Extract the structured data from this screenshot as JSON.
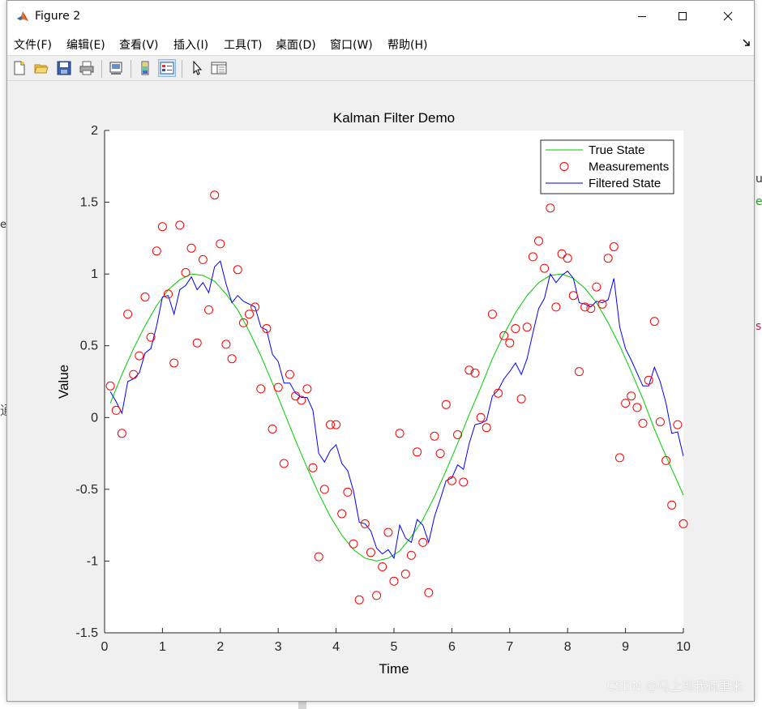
{
  "window": {
    "title": "Figure 2",
    "controls": {
      "minimize": "minimize",
      "maximize": "maximize",
      "close": "close"
    }
  },
  "menu": [
    {
      "label": "文件(F)"
    },
    {
      "label": "编辑(E)"
    },
    {
      "label": "查看(V)"
    },
    {
      "label": "插入(I)"
    },
    {
      "label": "工具(T)"
    },
    {
      "label": "桌面(D)"
    },
    {
      "label": "窗口(W)"
    },
    {
      "label": "帮助(H)"
    }
  ],
  "toolbar": {
    "icons": [
      "new-figure-icon",
      "open-file-icon",
      "save-icon",
      "print-icon",
      "link-plot-icon",
      "colorbar-icon",
      "legend-icon",
      "pointer-icon",
      "property-inspector-icon"
    ]
  },
  "background_fragments": {
    "left_e": "e",
    "left_glyph": "通",
    "right_u": "u",
    "right_e": "e",
    "right_s": "s"
  },
  "watermark": "CSDN @马上到我碗里来",
  "chart_data": {
    "type": "line",
    "title": "Kalman Filter Demo",
    "xlabel": "Time",
    "ylabel": "Value",
    "xlim": [
      0,
      10
    ],
    "ylim": [
      -1.5,
      2
    ],
    "xticks": [
      "0",
      "1",
      "2",
      "3",
      "4",
      "5",
      "6",
      "7",
      "8",
      "9",
      "10"
    ],
    "yticks": [
      "-1.5",
      "-1",
      "-0.5",
      "0",
      "0.5",
      "1",
      "1.5",
      "2"
    ],
    "legend_position": "top-right",
    "grid": false,
    "colors": {
      "true_state": "#00cc00",
      "measurements": "#ff0000",
      "filtered": "#0000ff",
      "axes_bg": "#ffffff"
    },
    "series": [
      {
        "name": "True State",
        "style": "line",
        "x": [
          0.1,
          0.3,
          0.5,
          0.7,
          0.9,
          1.1,
          1.3,
          1.5,
          1.7,
          1.9,
          2.1,
          2.3,
          2.5,
          2.7,
          2.9,
          3.1,
          3.3,
          3.5,
          3.7,
          3.9,
          4.1,
          4.3,
          4.5,
          4.7,
          4.9,
          5.1,
          5.3,
          5.5,
          5.7,
          5.9,
          6.1,
          6.3,
          6.5,
          6.7,
          6.9,
          7.1,
          7.3,
          7.5,
          7.7,
          7.9,
          8.1,
          8.3,
          8.5,
          8.7,
          8.9,
          9.1,
          9.3,
          9.5,
          9.7,
          10.0
        ],
        "y": [
          0.1,
          0.3,
          0.48,
          0.64,
          0.78,
          0.89,
          0.96,
          1.0,
          0.99,
          0.95,
          0.86,
          0.75,
          0.6,
          0.43,
          0.24,
          0.04,
          -0.16,
          -0.35,
          -0.53,
          -0.69,
          -0.82,
          -0.92,
          -0.98,
          -1.0,
          -0.98,
          -0.93,
          -0.83,
          -0.71,
          -0.55,
          -0.37,
          -0.18,
          0.02,
          0.21,
          0.41,
          0.58,
          0.73,
          0.85,
          0.94,
          0.99,
          1.0,
          0.97,
          0.9,
          0.8,
          0.66,
          0.5,
          0.32,
          0.13,
          -0.08,
          -0.27,
          -0.54
        ]
      },
      {
        "name": "Measurements",
        "style": "marker",
        "x": [
          0.1,
          0.2,
          0.3,
          0.4,
          0.5,
          0.6,
          0.7,
          0.8,
          0.9,
          1.0,
          1.1,
          1.2,
          1.3,
          1.4,
          1.5,
          1.6,
          1.7,
          1.8,
          1.9,
          2.0,
          2.1,
          2.2,
          2.3,
          2.4,
          2.5,
          2.6,
          2.7,
          2.8,
          2.9,
          3.0,
          3.1,
          3.2,
          3.3,
          3.4,
          3.5,
          3.6,
          3.7,
          3.8,
          3.9,
          4.0,
          4.1,
          4.2,
          4.3,
          4.4,
          4.5,
          4.6,
          4.7,
          4.8,
          4.9,
          5.0,
          5.1,
          5.2,
          5.3,
          5.4,
          5.5,
          5.6,
          5.7,
          5.8,
          5.9,
          6.0,
          6.1,
          6.2,
          6.3,
          6.4,
          6.5,
          6.6,
          6.7,
          6.8,
          6.9,
          7.0,
          7.1,
          7.2,
          7.3,
          7.4,
          7.5,
          7.6,
          7.7,
          7.8,
          7.9,
          8.0,
          8.1,
          8.2,
          8.3,
          8.4,
          8.5,
          8.6,
          8.7,
          8.8,
          8.9,
          9.0,
          9.1,
          9.2,
          9.3,
          9.4,
          9.5,
          9.6,
          9.7,
          9.8,
          9.9,
          10.0
        ],
        "y": [
          0.22,
          0.05,
          -0.11,
          0.72,
          0.3,
          0.43,
          0.84,
          0.56,
          1.16,
          1.33,
          0.86,
          0.38,
          1.34,
          1.01,
          1.18,
          0.52,
          1.1,
          0.75,
          1.55,
          1.21,
          0.51,
          0.41,
          1.03,
          0.66,
          0.72,
          0.77,
          0.2,
          0.62,
          -0.08,
          0.21,
          -0.32,
          0.3,
          0.15,
          0.12,
          0.2,
          -0.35,
          -0.97,
          -0.5,
          -0.05,
          -0.05,
          -0.67,
          -0.52,
          -0.88,
          -1.27,
          -0.74,
          -0.94,
          -1.24,
          -1.04,
          -0.8,
          -1.14,
          -0.11,
          -1.09,
          -0.96,
          -0.24,
          -0.87,
          -1.22,
          -0.13,
          -0.25,
          0.09,
          -0.44,
          -0.12,
          -0.45,
          0.33,
          0.31,
          0.0,
          -0.07,
          0.72,
          0.17,
          0.57,
          0.52,
          0.62,
          0.13,
          0.63,
          1.12,
          1.23,
          1.04,
          1.46,
          0.77,
          1.14,
          1.11,
          0.85,
          0.32,
          0.77,
          0.76,
          0.91,
          0.79,
          1.11,
          1.19,
          -0.28,
          0.1,
          0.15,
          0.07,
          -0.04,
          0.26,
          0.67,
          -0.03,
          -0.3,
          -0.61,
          -0.05,
          -0.74
        ]
      },
      {
        "name": "Filtered State",
        "style": "line",
        "x": [
          0.1,
          0.2,
          0.3,
          0.4,
          0.5,
          0.6,
          0.7,
          0.8,
          0.9,
          1.0,
          1.1,
          1.2,
          1.3,
          1.4,
          1.5,
          1.6,
          1.7,
          1.8,
          1.9,
          2.0,
          2.1,
          2.2,
          2.3,
          2.4,
          2.5,
          2.6,
          2.7,
          2.8,
          2.9,
          3.0,
          3.1,
          3.2,
          3.3,
          3.4,
          3.5,
          3.6,
          3.7,
          3.8,
          3.9,
          4.0,
          4.1,
          4.2,
          4.3,
          4.4,
          4.5,
          4.6,
          4.7,
          4.8,
          4.9,
          5.0,
          5.1,
          5.2,
          5.3,
          5.4,
          5.5,
          5.6,
          5.7,
          5.8,
          5.9,
          6.0,
          6.1,
          6.2,
          6.3,
          6.4,
          6.5,
          6.6,
          6.7,
          6.8,
          6.9,
          7.0,
          7.1,
          7.2,
          7.3,
          7.4,
          7.5,
          7.6,
          7.7,
          7.8,
          7.9,
          8.0,
          8.1,
          8.2,
          8.3,
          8.4,
          8.5,
          8.6,
          8.7,
          8.8,
          8.9,
          9.0,
          9.1,
          9.2,
          9.3,
          9.4,
          9.5,
          9.6,
          9.7,
          9.8,
          9.9,
          10.0
        ],
        "y": [
          0.18,
          0.11,
          0.03,
          0.25,
          0.27,
          0.31,
          0.45,
          0.48,
          0.64,
          0.84,
          0.85,
          0.72,
          0.89,
          0.92,
          0.98,
          0.89,
          0.94,
          0.87,
          1.05,
          1.09,
          0.93,
          0.8,
          0.85,
          0.81,
          0.79,
          0.77,
          0.63,
          0.61,
          0.44,
          0.39,
          0.24,
          0.24,
          0.17,
          0.14,
          0.14,
          0.05,
          -0.25,
          -0.31,
          -0.23,
          -0.19,
          -0.32,
          -0.37,
          -0.51,
          -0.73,
          -0.74,
          -0.79,
          -0.91,
          -0.95,
          -0.92,
          -0.98,
          -0.75,
          -0.84,
          -0.87,
          -0.71,
          -0.75,
          -0.87,
          -0.69,
          -0.57,
          -0.44,
          -0.42,
          -0.33,
          -0.36,
          -0.18,
          -0.05,
          -0.04,
          -0.02,
          0.15,
          0.19,
          0.27,
          0.32,
          0.38,
          0.3,
          0.41,
          0.59,
          0.76,
          0.83,
          1.0,
          0.94,
          0.99,
          1.02,
          0.97,
          0.8,
          0.79,
          0.77,
          0.81,
          0.8,
          0.82,
          0.97,
          0.63,
          0.48,
          0.4,
          0.31,
          0.22,
          0.22,
          0.35,
          0.25,
          0.1,
          -0.11,
          -0.1,
          -0.27
        ]
      }
    ]
  }
}
